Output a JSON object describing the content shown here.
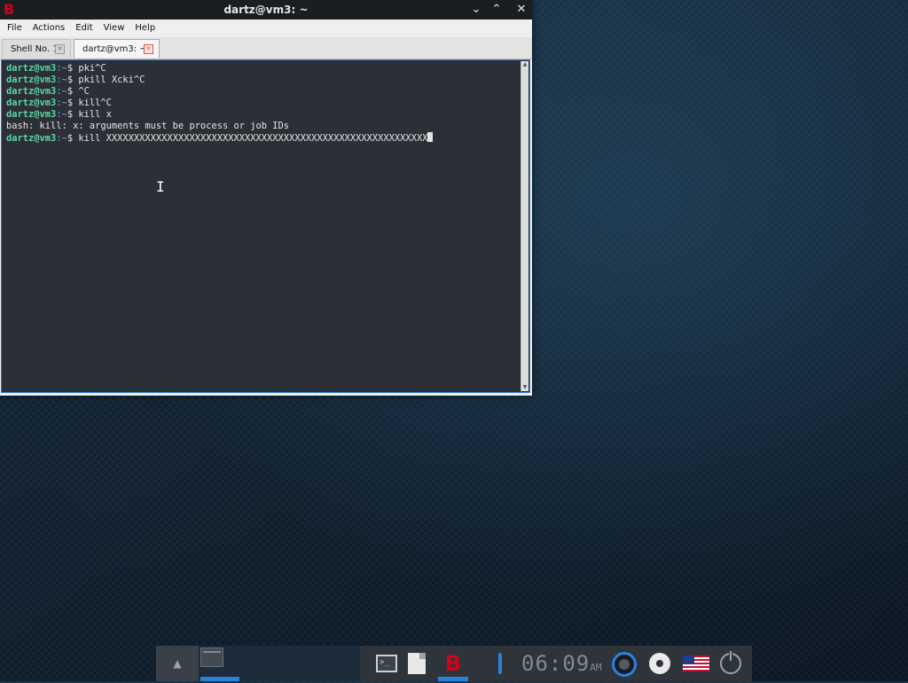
{
  "window": {
    "title": "dartz@vm3: ~",
    "buttons": {
      "minimize": "⌄",
      "maximize": "⌃",
      "close": "✕"
    },
    "app_icon": "app-logo-icon"
  },
  "menu": [
    "File",
    "Actions",
    "Edit",
    "View",
    "Help"
  ],
  "tabs": [
    {
      "label": "Shell No. 1",
      "active": false
    },
    {
      "label": "dartz@vm3: ~",
      "active": true
    }
  ],
  "terminal": {
    "prompt_user": "dartz@vm3",
    "prompt_path": ":~",
    "prompt_symbol": "$ ",
    "lines": [
      {
        "type": "cmd",
        "text": "pki^C"
      },
      {
        "type": "cmd",
        "text": "pkill Xcki^C"
      },
      {
        "type": "cmd",
        "text": "^C"
      },
      {
        "type": "cmd",
        "text": "kill^C"
      },
      {
        "type": "cmd",
        "text": "kill x"
      },
      {
        "type": "out",
        "text": "bash: kill: x: arguments must be process or job IDs"
      },
      {
        "type": "cmd",
        "text": "kill XXXXXXXXXXXXXXXXXXXXXXXXXXXXXXXXXXXXXXXXXXXXXXXXXXXXXXXXXX",
        "cursor": true
      }
    ]
  },
  "panel": {
    "clock": "06:09",
    "ampm": "AM",
    "icons": [
      "arrow-up-icon",
      "terminal-icon",
      "file-icon",
      "app-logo-icon",
      "thermometer-icon",
      "ring-icon",
      "disc-icon",
      "us-flag-icon",
      "power-icon"
    ]
  },
  "colors": {
    "accent": "#2a82da",
    "prompt_user": "#5ad7a8",
    "prompt_path": "#6aa4e8",
    "terminal_bg": "#2c2f35",
    "brand_red": "#d0021b"
  }
}
